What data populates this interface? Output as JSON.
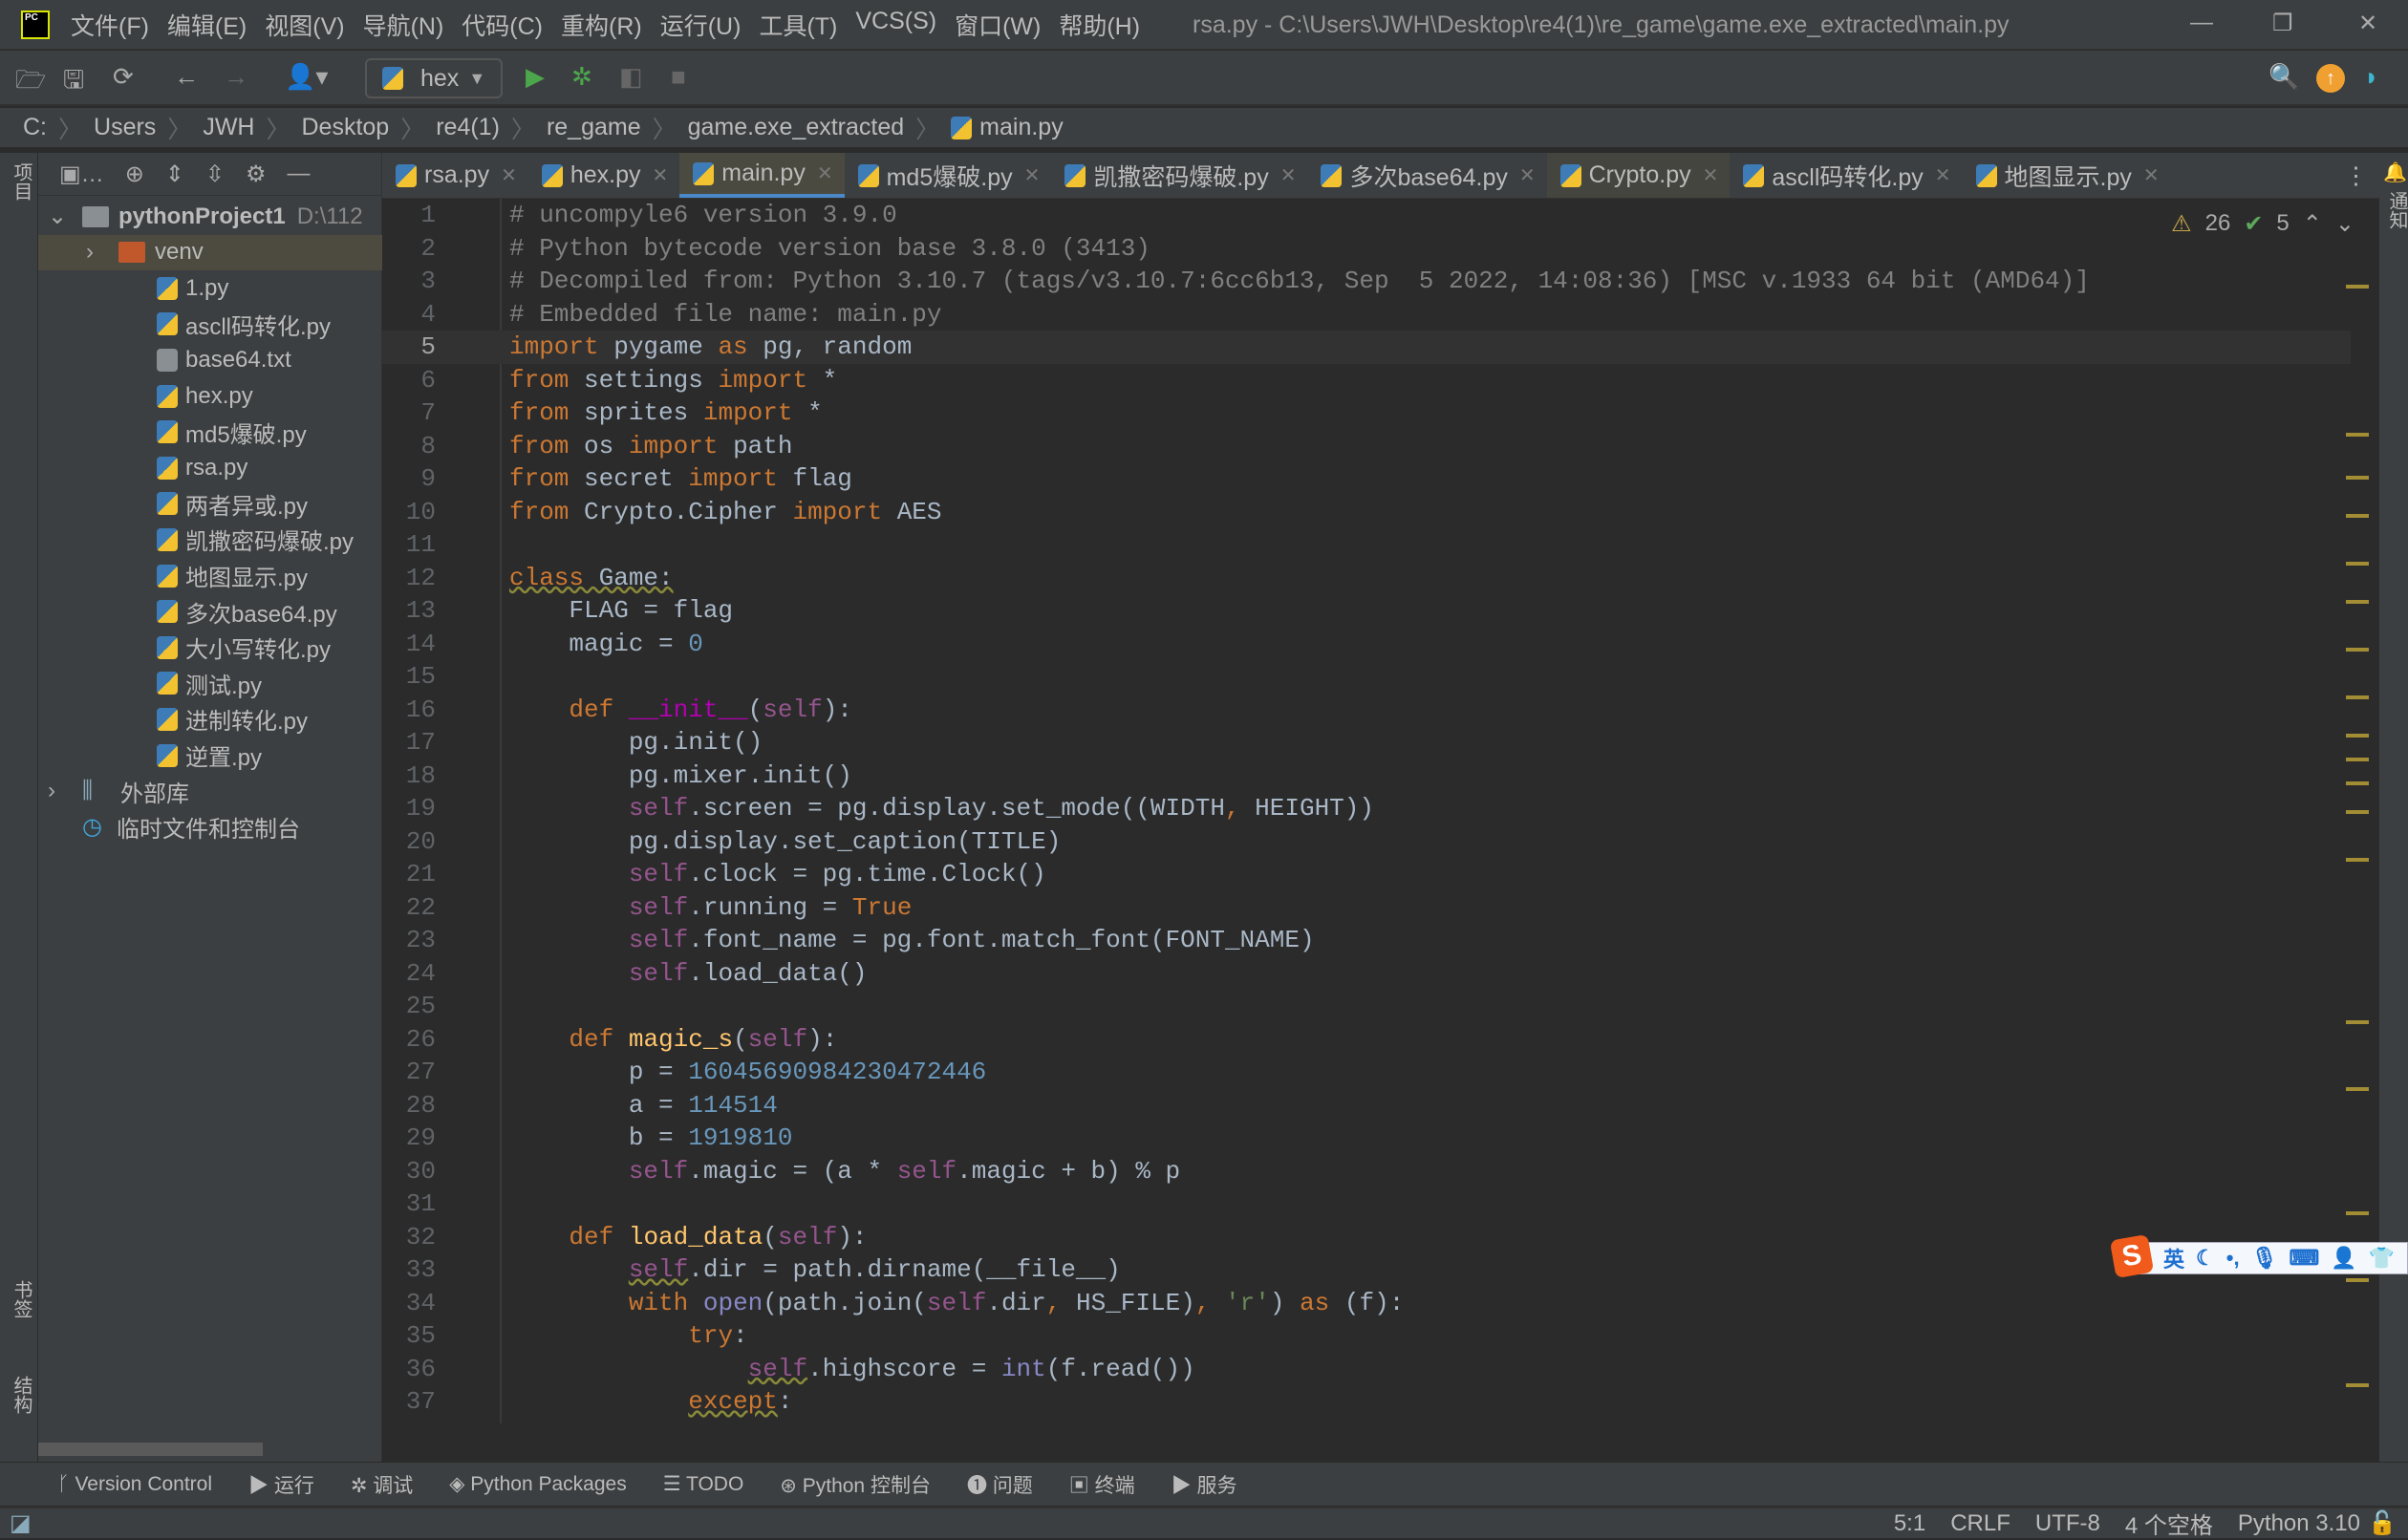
{
  "window": {
    "title": "rsa.py - C:\\Users\\JWH\\Desktop\\re4(1)\\re_game\\game.exe_extracted\\main.py",
    "logo": "PC"
  },
  "menu": [
    "文件(F)",
    "编辑(E)",
    "视图(V)",
    "导航(N)",
    "代码(C)",
    "重构(R)",
    "运行(U)",
    "工具(T)",
    "VCS(S)",
    "窗口(W)",
    "帮助(H)"
  ],
  "toolbar": {
    "run_config": "hex"
  },
  "breadcrumb": [
    "C:",
    "Users",
    "JWH",
    "Desktop",
    "re4(1)",
    "re_game",
    "game.exe_extracted",
    "main.py"
  ],
  "left_strip": {
    "top": "项目",
    "bookmarks": "书签",
    "structure": "结构"
  },
  "right_strip": {
    "notifications": "通知"
  },
  "project": {
    "root": "pythonProject1",
    "root_path": "D:\\112",
    "items": [
      {
        "label": "venv",
        "type": "folder",
        "selected": true
      },
      {
        "label": "1.py",
        "type": "py"
      },
      {
        "label": "ascll码转化.py",
        "type": "py"
      },
      {
        "label": "base64.txt",
        "type": "txt"
      },
      {
        "label": "hex.py",
        "type": "py"
      },
      {
        "label": "md5爆破.py",
        "type": "py"
      },
      {
        "label": "rsa.py",
        "type": "py"
      },
      {
        "label": "两者异或.py",
        "type": "py"
      },
      {
        "label": "凯撒密码爆破.py",
        "type": "py"
      },
      {
        "label": "地图显示.py",
        "type": "py"
      },
      {
        "label": "多次base64.py",
        "type": "py"
      },
      {
        "label": "大小写转化.py",
        "type": "py"
      },
      {
        "label": "测试.py",
        "type": "py"
      },
      {
        "label": "进制转化.py",
        "type": "py"
      },
      {
        "label": "逆置.py",
        "type": "py"
      }
    ],
    "external": "外部库",
    "scratches": "临时文件和控制台"
  },
  "tabs": [
    {
      "label": "rsa.py"
    },
    {
      "label": "hex.py"
    },
    {
      "label": "main.py",
      "active": true
    },
    {
      "label": "md5爆破.py"
    },
    {
      "label": "凯撒密码爆破.py"
    },
    {
      "label": "多次base64.py"
    },
    {
      "label": "Crypto.py",
      "highlight": true
    },
    {
      "label": "ascll码转化.py"
    },
    {
      "label": "地图显示.py"
    }
  ],
  "inspections": {
    "warnings": "26",
    "weak_warnings": "5"
  },
  "editor": {
    "current_line": 5,
    "lines": [
      [
        [
          "c",
          "# uncompyle6 version 3.9.0"
        ]
      ],
      [
        [
          "c",
          "# Python bytecode version base 3.8.0 (3413)"
        ]
      ],
      [
        [
          "c",
          "# Decompiled from: Python 3.10.7 (tags/v3.10.7:6cc6b13, Sep  5 2022, 14:08:36) [MSC v.1933 64 bit (AMD64)]"
        ]
      ],
      [
        [
          "c",
          "# Embedded file name: main.py"
        ]
      ],
      [
        [
          "k",
          "import"
        ],
        [
          "t",
          " pygame "
        ],
        [
          "k",
          "as"
        ],
        [
          "t",
          " pg, random"
        ]
      ],
      [
        [
          "k",
          "from"
        ],
        [
          "t",
          " settings "
        ],
        [
          "k",
          "import"
        ],
        [
          "t",
          " *"
        ]
      ],
      [
        [
          "k",
          "from"
        ],
        [
          "t",
          " sprites "
        ],
        [
          "k",
          "import"
        ],
        [
          "t",
          " *"
        ]
      ],
      [
        [
          "k",
          "from"
        ],
        [
          "t",
          " os "
        ],
        [
          "k",
          "import"
        ],
        [
          "t",
          " path"
        ]
      ],
      [
        [
          "k",
          "from"
        ],
        [
          "t",
          " secret "
        ],
        [
          "k",
          "import"
        ],
        [
          "t",
          " flag"
        ]
      ],
      [
        [
          "k",
          "from"
        ],
        [
          "t",
          " Crypto.Cipher "
        ],
        [
          "k",
          "import"
        ],
        [
          "t",
          " AES"
        ]
      ],
      [],
      [
        [
          "k",
          "class"
        ],
        [
          "t",
          " Game:"
        ]
      ],
      [
        [
          "t",
          "    FLAG = flag"
        ]
      ],
      [
        [
          "t",
          "    magic = "
        ],
        [
          "n",
          "0"
        ]
      ],
      [],
      [
        [
          "t",
          "    "
        ],
        [
          "k",
          "def"
        ],
        [
          "t",
          " "
        ],
        [
          "m",
          "__init__"
        ],
        [
          "t",
          "("
        ],
        [
          "s",
          "self"
        ],
        [
          "t",
          "):"
        ]
      ],
      [
        [
          "t",
          "        pg.init()"
        ]
      ],
      [
        [
          "t",
          "        pg.mixer.init()"
        ]
      ],
      [
        [
          "t",
          "        "
        ],
        [
          "s",
          "self"
        ],
        [
          "t",
          ".screen = pg.display.set_mode((WIDTH"
        ],
        [
          "k",
          ","
        ],
        [
          "t",
          " HEIGHT))"
        ]
      ],
      [
        [
          "t",
          "        pg.display.set_caption(TITLE)"
        ]
      ],
      [
        [
          "t",
          "        "
        ],
        [
          "s",
          "self"
        ],
        [
          "t",
          ".clock = pg.time.Clock()"
        ]
      ],
      [
        [
          "t",
          "        "
        ],
        [
          "s",
          "self"
        ],
        [
          "t",
          ".running = "
        ],
        [
          "k",
          "True"
        ]
      ],
      [
        [
          "t",
          "        "
        ],
        [
          "s",
          "self"
        ],
        [
          "t",
          ".font_name = pg.font.match_font(FONT_NAME)"
        ]
      ],
      [
        [
          "t",
          "        "
        ],
        [
          "s",
          "self"
        ],
        [
          "t",
          ".load_data()"
        ]
      ],
      [],
      [
        [
          "t",
          "    "
        ],
        [
          "k",
          "def"
        ],
        [
          "t",
          " "
        ],
        [
          "f",
          "magic_s"
        ],
        [
          "t",
          "("
        ],
        [
          "s",
          "self"
        ],
        [
          "t",
          "):"
        ]
      ],
      [
        [
          "t",
          "        p = "
        ],
        [
          "n",
          "16045690984230472446"
        ]
      ],
      [
        [
          "t",
          "        a = "
        ],
        [
          "n",
          "114514"
        ]
      ],
      [
        [
          "t",
          "        b = "
        ],
        [
          "n",
          "1919810"
        ]
      ],
      [
        [
          "t",
          "        "
        ],
        [
          "s",
          "self"
        ],
        [
          "t",
          ".magic = (a * "
        ],
        [
          "s",
          "self"
        ],
        [
          "t",
          ".magic + b) % p"
        ]
      ],
      [],
      [
        [
          "t",
          "    "
        ],
        [
          "k",
          "def"
        ],
        [
          "t",
          " "
        ],
        [
          "f",
          "load_data"
        ],
        [
          "t",
          "("
        ],
        [
          "s",
          "self"
        ],
        [
          "t",
          "):"
        ]
      ],
      [
        [
          "t",
          "        "
        ],
        [
          "s",
          "self"
        ],
        [
          "t",
          ".dir = path.dirname(__file__)"
        ]
      ],
      [
        [
          "t",
          "        "
        ],
        [
          "k",
          "with"
        ],
        [
          "t",
          " "
        ],
        [
          "b",
          "open"
        ],
        [
          "t",
          "(path.join("
        ],
        [
          "s",
          "self"
        ],
        [
          "t",
          ".dir"
        ],
        [
          "k",
          ","
        ],
        [
          "t",
          " HS_FILE)"
        ],
        [
          "k",
          ","
        ],
        [
          "t",
          " "
        ],
        [
          "str",
          "'r'"
        ],
        [
          "t",
          ") "
        ],
        [
          "k",
          "as"
        ],
        [
          "t",
          " (f):"
        ]
      ],
      [
        [
          "t",
          "            "
        ],
        [
          "k",
          "try"
        ],
        [
          "t",
          ":"
        ]
      ],
      [
        [
          "t",
          "                "
        ],
        [
          "s",
          "self"
        ],
        [
          "t",
          ".highscore = "
        ],
        [
          "b",
          "int"
        ],
        [
          "t",
          "(f.read())"
        ]
      ],
      [
        [
          "t",
          "            "
        ],
        [
          "k",
          "except"
        ],
        [
          "t",
          ":"
        ]
      ]
    ]
  },
  "tool_windows": [
    "Version Control",
    "运行",
    "调试",
    "Python Packages",
    "TODO",
    "Python 控制台",
    "问题",
    "终端",
    "服务"
  ],
  "status": {
    "position": "5:1",
    "line_sep": "CRLF",
    "encoding": "UTF-8",
    "indent": "4 个空格",
    "interpreter": "Python 3.10"
  },
  "ime": {
    "logo": "S",
    "mode": "英"
  }
}
